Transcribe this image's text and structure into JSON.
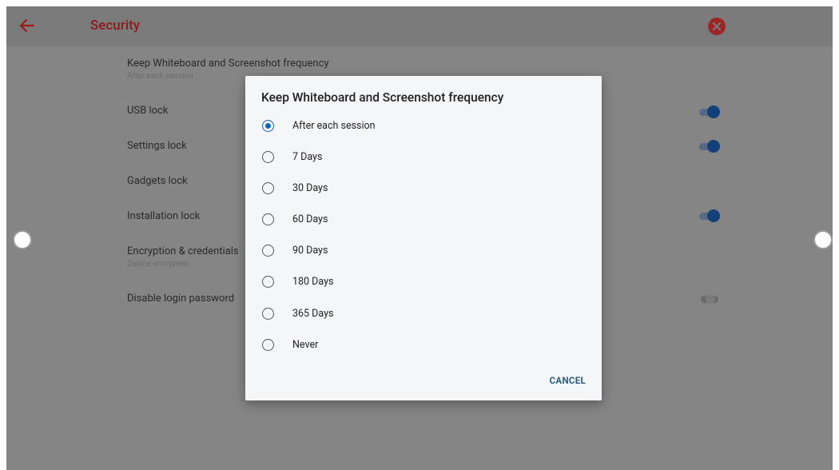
{
  "appbar": {
    "title": "Security",
    "back_icon": "arrow-left-icon",
    "close_icon": "close-circle-icon"
  },
  "settings": [
    {
      "label": "Keep Whiteboard and Screenshot frequency",
      "sub": "After each session",
      "toggle": null
    },
    {
      "label": "USB lock",
      "sub": "",
      "toggle": "on"
    },
    {
      "label": "Settings lock",
      "sub": "",
      "toggle": "on"
    },
    {
      "label": "Gadgets lock",
      "sub": "",
      "toggle": null
    },
    {
      "label": "Installation lock",
      "sub": "",
      "toggle": "on"
    },
    {
      "label": "Encryption & credentials",
      "sub": "Device encrypted",
      "toggle": null
    },
    {
      "label": "Disable login password",
      "sub": "",
      "toggle": "off"
    }
  ],
  "dialog": {
    "title": "Keep Whiteboard and Screenshot frequency",
    "options": [
      "After each session",
      "7 Days",
      "30 Days",
      "60 Days",
      "90 Days",
      "180 Days",
      "365 Days",
      "Never"
    ],
    "selected": "After each session",
    "cancel_label": "CANCEL"
  },
  "colors": {
    "accent": "#1565c0",
    "brand": "#b71c1c",
    "toggle_on": "#14407a"
  }
}
